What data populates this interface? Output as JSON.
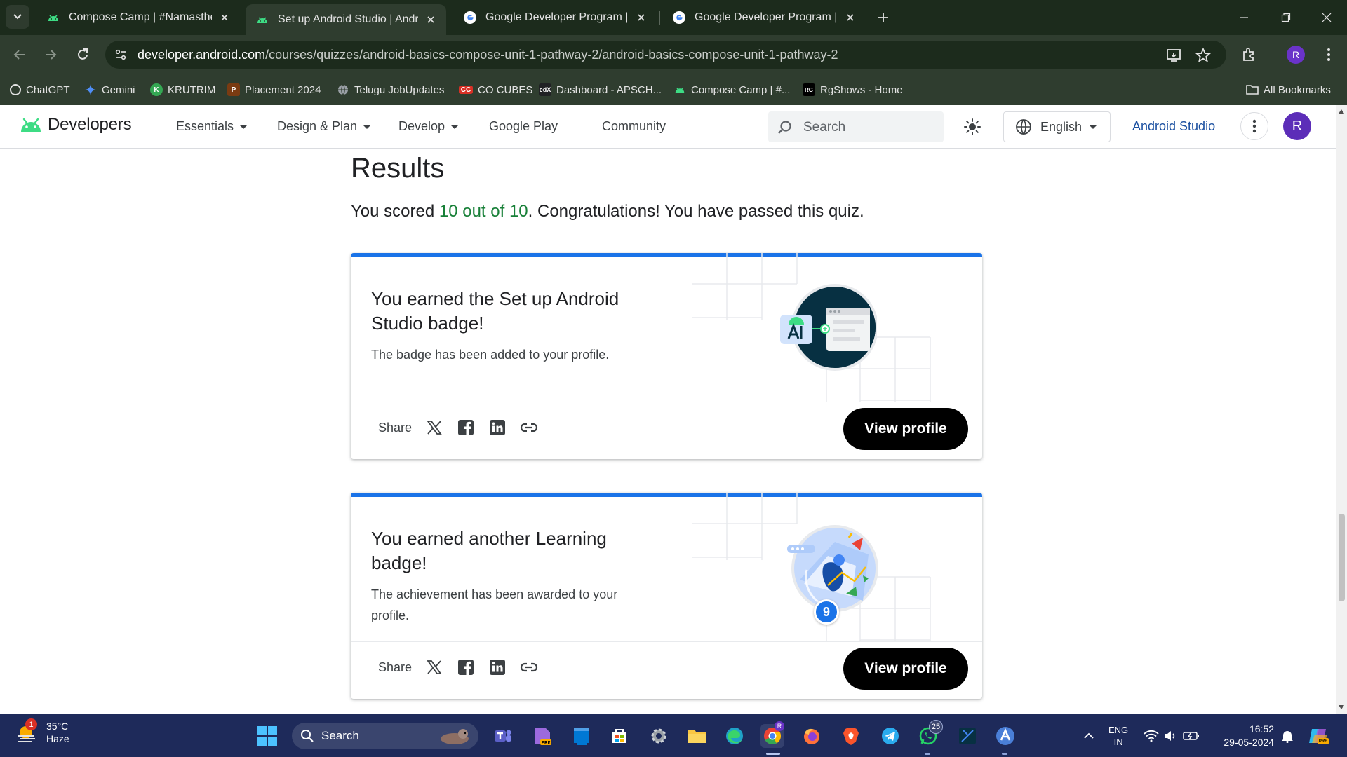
{
  "browser": {
    "tabs": [
      {
        "title": "Compose Camp | #NamastheAndroid",
        "icon": "android-icon"
      },
      {
        "title": "Set up Android Studio | Android Developers",
        "icon": "android-icon",
        "active": true
      },
      {
        "title": "Google Developer Program | Google",
        "icon": "google-icon"
      },
      {
        "title": "Google Developer Program | Google",
        "icon": "google-icon"
      }
    ],
    "url_domain": "developer.android.com",
    "url_path": "/courses/quizzes/android-basics-compose-unit-1-pathway-2/android-basics-compose-unit-1-pathway-2",
    "profile_initial": "R",
    "bookmarks": [
      {
        "label": "ChatGPT",
        "color": "#ffffff"
      },
      {
        "label": "Gemini",
        "color": "#4f8ef7"
      },
      {
        "label": "KRUTRIM",
        "color": "#34a853"
      },
      {
        "label": "Placement 2024",
        "color": "#7a3b12"
      },
      {
        "label": "Telugu JobUpdates",
        "color": "#9aa0a6"
      },
      {
        "label": "CO CUBES",
        "color": "#d93025"
      },
      {
        "label": "Dashboard - APSCH...",
        "color": "#202124"
      },
      {
        "label": "Compose Camp | #...",
        "color": "#3ddc84"
      },
      {
        "label": "RgShows - Home",
        "color": "#000000"
      }
    ],
    "all_bookmarks": "All Bookmarks"
  },
  "site": {
    "logo_text": "Developers",
    "nav": [
      {
        "label": "Essentials",
        "dropdown": true
      },
      {
        "label": "Design & Plan",
        "dropdown": true
      },
      {
        "label": "Develop",
        "dropdown": true
      },
      {
        "label": "Google Play",
        "dropdown": false
      },
      {
        "label": "Community",
        "dropdown": false
      }
    ],
    "search_placeholder": "Search",
    "language": "English",
    "studio_link": "Android Studio",
    "avatar_initial": "R"
  },
  "results": {
    "title": "Results",
    "score_prefix": "You scored ",
    "score": "10 out of 10",
    "score_suffix": ". Congratulations! You have passed this quiz.",
    "score_color": "#188038"
  },
  "badges": [
    {
      "heading_pre": "You earned the ",
      "heading_bold": "Set up Android Studio",
      "heading_post": " badge!",
      "description": "The badge has been added to your profile.",
      "share_label": "Share",
      "button": "View profile"
    },
    {
      "heading_pre": "You earned another ",
      "heading_bold": "Learning",
      "heading_post": " badge!",
      "description": "The achievement has been awarded to your profile.",
      "share_label": "Share",
      "button": "View profile",
      "count": "9"
    }
  ],
  "taskbar": {
    "weather_temp": "35°C",
    "weather_desc": "Haze",
    "weather_alert": "1",
    "search": "Search",
    "whatsapp_badge": "25",
    "lang_line1": "ENG",
    "lang_line2": "IN",
    "time": "16:52",
    "date": "29-05-2024"
  },
  "colors": {
    "accent_blue": "#1a73e8",
    "chrome_green": "#2f3d2f",
    "taskbar": "#1e2a5a"
  }
}
